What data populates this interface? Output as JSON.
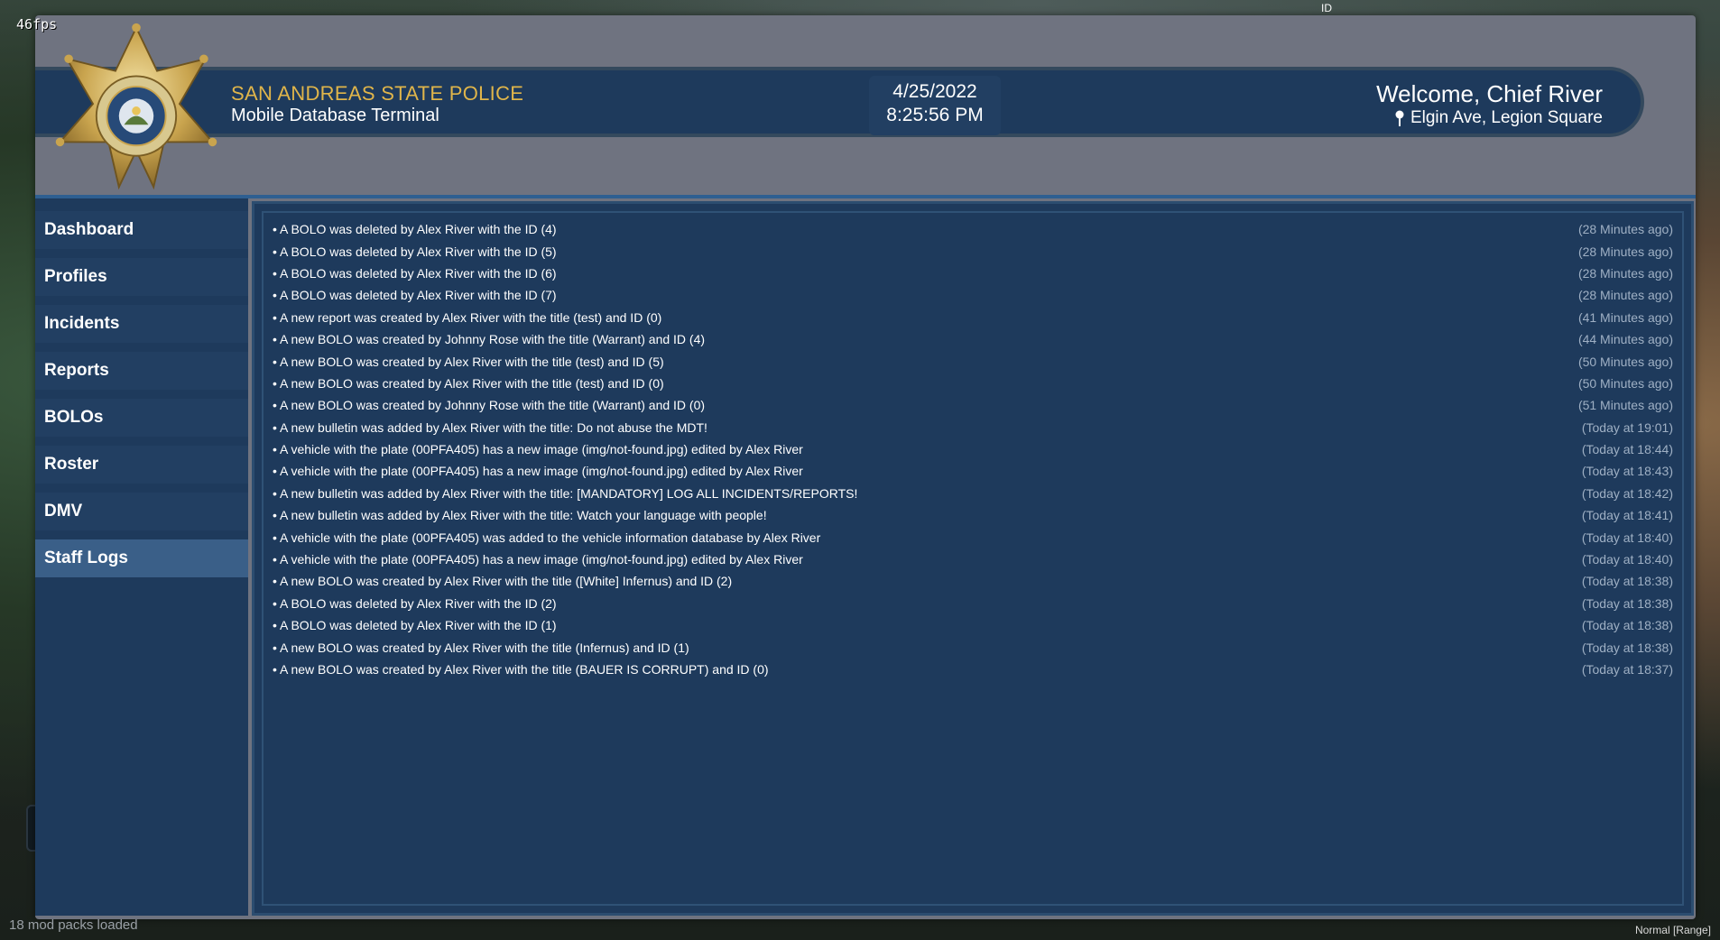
{
  "overlay": {
    "fps": "46fps",
    "id_label": "ID",
    "mod_packs": "18 mod packs loaded",
    "mode": "Normal [Range]"
  },
  "header": {
    "agency": "SAN ANDREAS STATE POLICE",
    "subtitle": "Mobile Database Terminal",
    "date": "4/25/2022",
    "time": "8:25:56 PM",
    "welcome": "Welcome, Chief River",
    "location": "Elgin Ave, Legion Square",
    "badge_text": "SAN ANDREAS STATE POLICE"
  },
  "sidebar": {
    "items": [
      {
        "label": "Dashboard",
        "active": false
      },
      {
        "label": "Profiles",
        "active": false
      },
      {
        "label": "Incidents",
        "active": false
      },
      {
        "label": "Reports",
        "active": false
      },
      {
        "label": "BOLOs",
        "active": false
      },
      {
        "label": "Roster",
        "active": false
      },
      {
        "label": "DMV",
        "active": false
      },
      {
        "label": "Staff Logs",
        "active": true
      }
    ]
  },
  "logs": [
    {
      "text": "• A BOLO was deleted by Alex River with the ID (4)",
      "time": "(28 Minutes ago)"
    },
    {
      "text": "• A BOLO was deleted by Alex River with the ID (5)",
      "time": "(28 Minutes ago)"
    },
    {
      "text": "• A BOLO was deleted by Alex River with the ID (6)",
      "time": "(28 Minutes ago)"
    },
    {
      "text": "• A BOLO was deleted by Alex River with the ID (7)",
      "time": "(28 Minutes ago)"
    },
    {
      "text": "• A new report was created by Alex River with the title (test) and ID (0)",
      "time": "(41 Minutes ago)"
    },
    {
      "text": "• A new BOLO was created by Johnny Rose with the title (Warrant) and ID (4)",
      "time": "(44 Minutes ago)"
    },
    {
      "text": "• A new BOLO was created by Alex River with the title (test) and ID (5)",
      "time": "(50 Minutes ago)"
    },
    {
      "text": "• A new BOLO was created by Alex River with the title (test) and ID (0)",
      "time": "(50 Minutes ago)"
    },
    {
      "text": "• A new BOLO was created by Johnny Rose with the title (Warrant) and ID (0)",
      "time": "(51 Minutes ago)"
    },
    {
      "text": "• A new bulletin was added by Alex River with the title: Do not abuse the MDT!",
      "time": "(Today at 19:01)"
    },
    {
      "text": "• A vehicle with the plate (00PFA405) has a new image (img/not-found.jpg) edited by Alex River",
      "time": "(Today at 18:44)"
    },
    {
      "text": "• A vehicle with the plate (00PFA405) has a new image (img/not-found.jpg) edited by Alex River",
      "time": "(Today at 18:43)"
    },
    {
      "text": "• A new bulletin was added by Alex River with the title: [MANDATORY] LOG ALL INCIDENTS/REPORTS!",
      "time": "(Today at 18:42)"
    },
    {
      "text": "• A new bulletin was added by Alex River with the title: Watch your language with people!",
      "time": "(Today at 18:41)"
    },
    {
      "text": "• A vehicle with the plate (00PFA405) was added to the vehicle information database by Alex River",
      "time": "(Today at 18:40)"
    },
    {
      "text": "• A vehicle with the plate (00PFA405) has a new image (img/not-found.jpg) edited by Alex River",
      "time": "(Today at 18:40)"
    },
    {
      "text": "• A new BOLO was created by Alex River with the title ([White] Infernus) and ID (2)",
      "time": "(Today at 18:38)"
    },
    {
      "text": "• A BOLO was deleted by Alex River with the ID (2)",
      "time": "(Today at 18:38)"
    },
    {
      "text": "• A BOLO was deleted by Alex River with the ID (1)",
      "time": "(Today at 18:38)"
    },
    {
      "text": "• A new BOLO was created by Alex River with the title (Infernus) and ID (1)",
      "time": "(Today at 18:38)"
    },
    {
      "text": "• A new BOLO was created by Alex River with the title (BAUER IS CORRUPT) and ID (0)",
      "time": "(Today at 18:37)"
    }
  ],
  "colors": {
    "panel": "#1e3a5c",
    "frame": "#6f7380",
    "accent_gold": "#e0b54a",
    "active_nav": "#3a5f88"
  }
}
